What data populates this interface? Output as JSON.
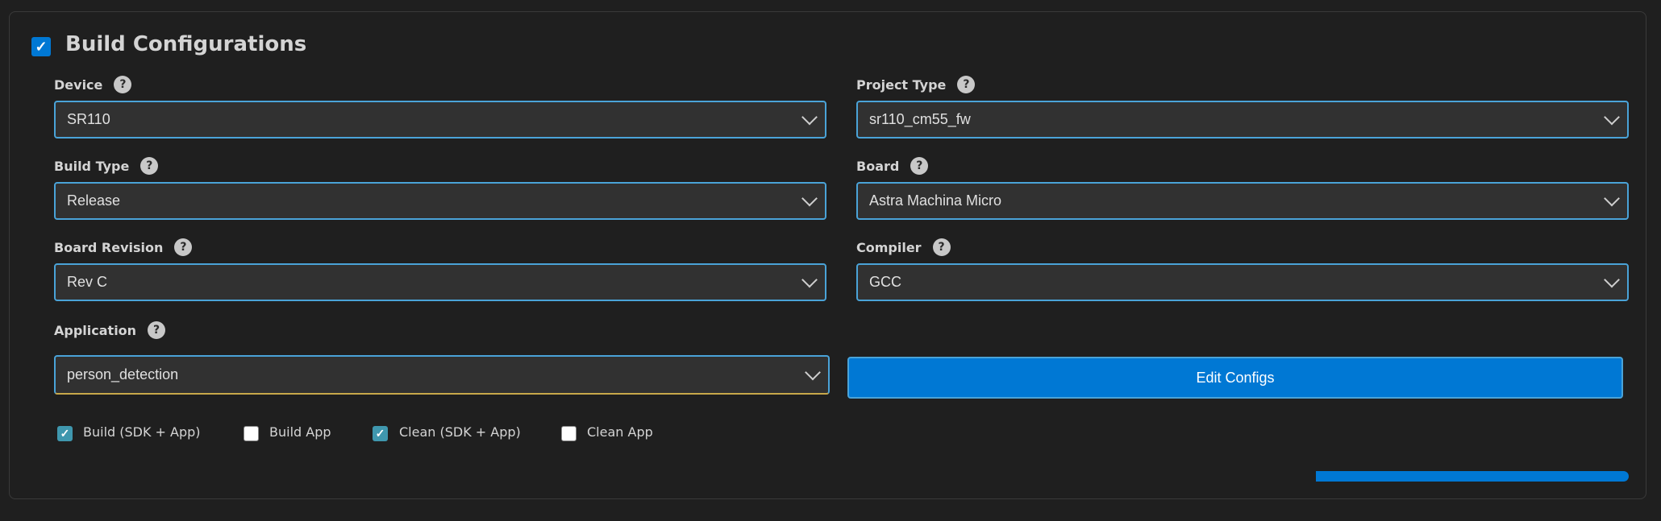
{
  "header": {
    "title": "Build Configurations",
    "enabled": true
  },
  "fields": {
    "device": {
      "label": "Device",
      "value": "SR110"
    },
    "project_type": {
      "label": "Project Type",
      "value": "sr110_cm55_fw"
    },
    "build_type": {
      "label": "Build Type",
      "value": "Release"
    },
    "board": {
      "label": "Board",
      "value": "Astra Machina Micro"
    },
    "board_revision": {
      "label": "Board Revision",
      "value": "Rev C"
    },
    "compiler": {
      "label": "Compiler",
      "value": "GCC"
    },
    "application": {
      "label": "Application",
      "value": "person_detection"
    }
  },
  "help_icon": "?",
  "check_glyph": "✓",
  "edit_button": "Edit Configs",
  "options": [
    {
      "label": "Build (SDK + App)",
      "checked": true
    },
    {
      "label": "Build App",
      "checked": false
    },
    {
      "label": "Clean (SDK + App)",
      "checked": true
    },
    {
      "label": "Clean App",
      "checked": false
    }
  ],
  "progress_percent": 100,
  "colors": {
    "accent": "#0078d4",
    "checkbox": "#3f97ae",
    "border": "#4aa3d8"
  }
}
